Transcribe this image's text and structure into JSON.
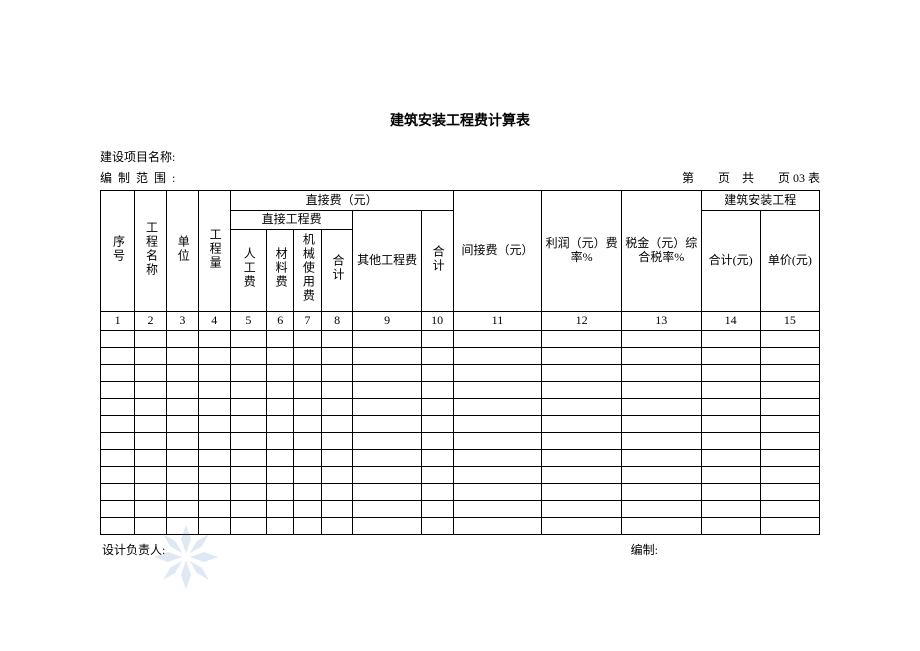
{
  "title": "建筑安装工程费计算表",
  "meta": {
    "project_label": "建设项目名称:",
    "scope_label": "编制范围:",
    "page_info": "第　　页　共　　页 03 表",
    "designer_label": "设计负责人:",
    "compiler_label": "编制:"
  },
  "headers": {
    "seq": "序号",
    "project_name": "工程名称",
    "unit": "单位",
    "quantity": "工程量",
    "direct_cost": "直接费（元）",
    "direct_engineering": "直接工程费",
    "labor": "人工费",
    "material": "材料费",
    "machine": "机械使用费",
    "subtotal1": "合计",
    "other_eng": "其他工程费",
    "subtotal2": "合计",
    "indirect": "间接费（元）",
    "profit": "利润（元）费率%",
    "tax": "税金（元）综合税率%",
    "install": "建筑安装工程",
    "total": "合计(元)",
    "unit_price": "单价(元)"
  },
  "nums": [
    "1",
    "2",
    "3",
    "4",
    "5",
    "6",
    "7",
    "8",
    "9",
    "10",
    "11",
    "12",
    "13",
    "14",
    "15"
  ],
  "empty_rows": 12
}
